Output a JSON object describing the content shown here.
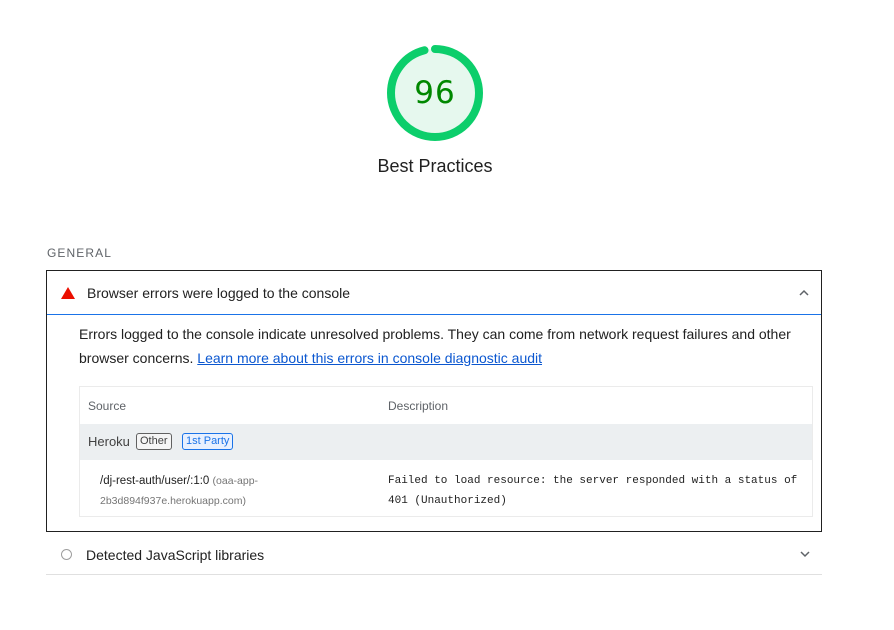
{
  "score": {
    "value": "96",
    "percent": 96,
    "color": "#0cce6b",
    "fill_color": "#e6f8ee",
    "text_color": "#008800",
    "title": "Best Practices"
  },
  "group": {
    "title": "GENERAL"
  },
  "audits": [
    {
      "title": "Browser errors were logged to the console",
      "status": "fail",
      "icon": "warning-triangle-icon",
      "expanded": true,
      "description": "Errors logged to the console indicate unresolved problems. They can come from network request failures and other browser concerns. ",
      "learn_more": "Learn more about this errors in console diagnostic audit",
      "table": {
        "headers": {
          "source": "Source",
          "description": "Description"
        },
        "entity": {
          "name": "Heroku",
          "chips": [
            "Other",
            "1st Party"
          ]
        },
        "items": [
          {
            "url": "/dj-rest-auth/user/:1:0",
            "origin": "(oaa-app-2b3d894f937e.herokuapp.com)",
            "message": "Failed to load resource: the server responded with a status of 401 (Unauthorized)"
          }
        ]
      }
    },
    {
      "title": "Detected JavaScript libraries",
      "status": "informative",
      "icon": "circle-outline-icon",
      "expanded": false
    }
  ]
}
